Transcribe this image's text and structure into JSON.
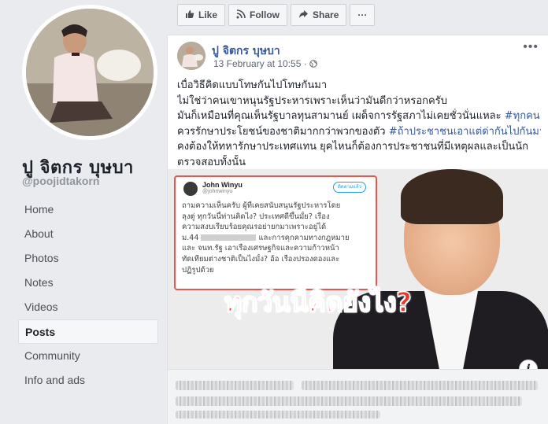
{
  "profile": {
    "name": "ปู จิตกร บุษบา",
    "handle": "@poojidtakorn"
  },
  "nav": {
    "items": [
      {
        "label": "Home",
        "active": false
      },
      {
        "label": "About",
        "active": false
      },
      {
        "label": "Photos",
        "active": false
      },
      {
        "label": "Notes",
        "active": false
      },
      {
        "label": "Videos",
        "active": false
      },
      {
        "label": "Posts",
        "active": true
      },
      {
        "label": "Community",
        "active": false
      },
      {
        "label": "Info and ads",
        "active": false
      }
    ]
  },
  "actions": {
    "like_label": "Like",
    "follow_label": "Follow",
    "share_label": "Share",
    "more_label": "···"
  },
  "post": {
    "author": "ปู จิตกร บุษบา",
    "timestamp": "13 February at 10:55 · ",
    "privacy_icon": "globe-icon",
    "more_label": "•••",
    "text_lines": [
      "เบื่อวิธีคิดแบบโทษกันไปโทษกันมา",
      "ไม่ใช่ว่าคนเขาหนุนรัฐประหารเพราะเห็นว่ามันดีกว่าหรอกครับ",
      "มันก็เหมือนที่คุณเห็นรัฐบาลทุนสามานย์ เผด็จการรัฐสภาไม่เคยชั่วนั่นแหละ ",
      "ควรรักษาประโยชน์ของชาติมากกว่าพวกของตัว ",
      "คงต้องให้ทหารักษาประเทศแทน ยุคไหนก็ต้องการประชาชนที่มีเหตุผลและเป็นนัก",
      "ตรวจสอบทั้งนั้น"
    ],
    "hashtag_1": "#ทุกคน",
    "hashtag_2": "#ถ้าประชาชนเอาแต่ด่ากันไปกันมา",
    "image": {
      "tweet": {
        "name": "John Winyu",
        "handle": "@johnwinyu",
        "follow": "ติดตามแล้ว",
        "lines": [
          "ถามความเห็นครับ ผู้ที่เคยสนับสนุนรัฐประหารโดย",
          "ลุงตู่ ทุกวันนี้ท่านคิดไง? ประเทศดีขึ้นมั้ย? เรื่อง",
          "ความสงบเรียบร้อยคุณรอย่ายกมาเพราะอยู่ได้",
          "ม.44",
          "และการคุกคามทางกฎหมาย",
          "และ จนท.รัฐ เอาเรื่องเศรษฐกิจและความก้าวหน้า",
          "ทัดเทียมต่างชาติเป็นไงมั้ง? อ้อ เรื่องปรองดองและ",
          "ปฏิรูปด้วย"
        ]
      },
      "headline": "ทุกวันนี้คิดยังไง?",
      "info_label": "i"
    }
  }
}
